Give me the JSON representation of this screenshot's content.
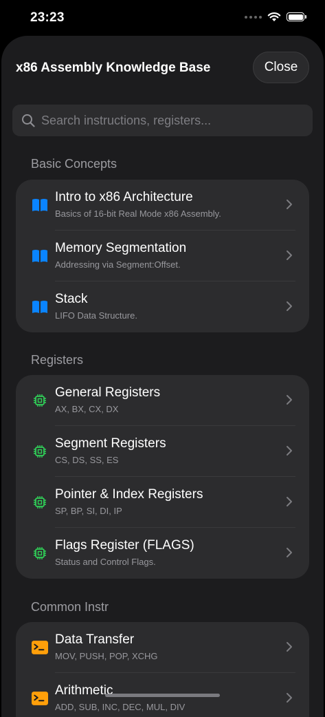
{
  "status": {
    "time": "23:23"
  },
  "sheet": {
    "title": "x86 Assembly Knowledge Base",
    "close_label": "Close",
    "search_placeholder": "Search instructions, registers..."
  },
  "colors": {
    "book": "#0a84ff",
    "chip": "#30d158",
    "terminal": "#ff9f0a"
  },
  "sections": [
    {
      "header": "Basic Concepts",
      "icon": "book-icon",
      "items": [
        {
          "title": "Intro to x86 Architecture",
          "subtitle": "Basics of 16-bit Real Mode x86 Assembly."
        },
        {
          "title": "Memory Segmentation",
          "subtitle": "Addressing via Segment:Offset."
        },
        {
          "title": "Stack",
          "subtitle": "LIFO Data Structure."
        }
      ]
    },
    {
      "header": "Registers",
      "icon": "cpu-chip-icon",
      "items": [
        {
          "title": "General Registers",
          "subtitle": "AX, BX, CX, DX"
        },
        {
          "title": "Segment Registers",
          "subtitle": "CS, DS, SS, ES"
        },
        {
          "title": "Pointer & Index Registers",
          "subtitle": "SP, BP, SI, DI, IP"
        },
        {
          "title": "Flags Register (FLAGS)",
          "subtitle": "Status and Control Flags."
        }
      ]
    },
    {
      "header": "Common Instr",
      "icon": "terminal-icon",
      "items": [
        {
          "title": "Data Transfer",
          "subtitle": "MOV, PUSH, POP, XCHG"
        },
        {
          "title": "Arithmetic",
          "subtitle": "ADD, SUB, INC, DEC, MUL, DIV"
        }
      ]
    }
  ]
}
